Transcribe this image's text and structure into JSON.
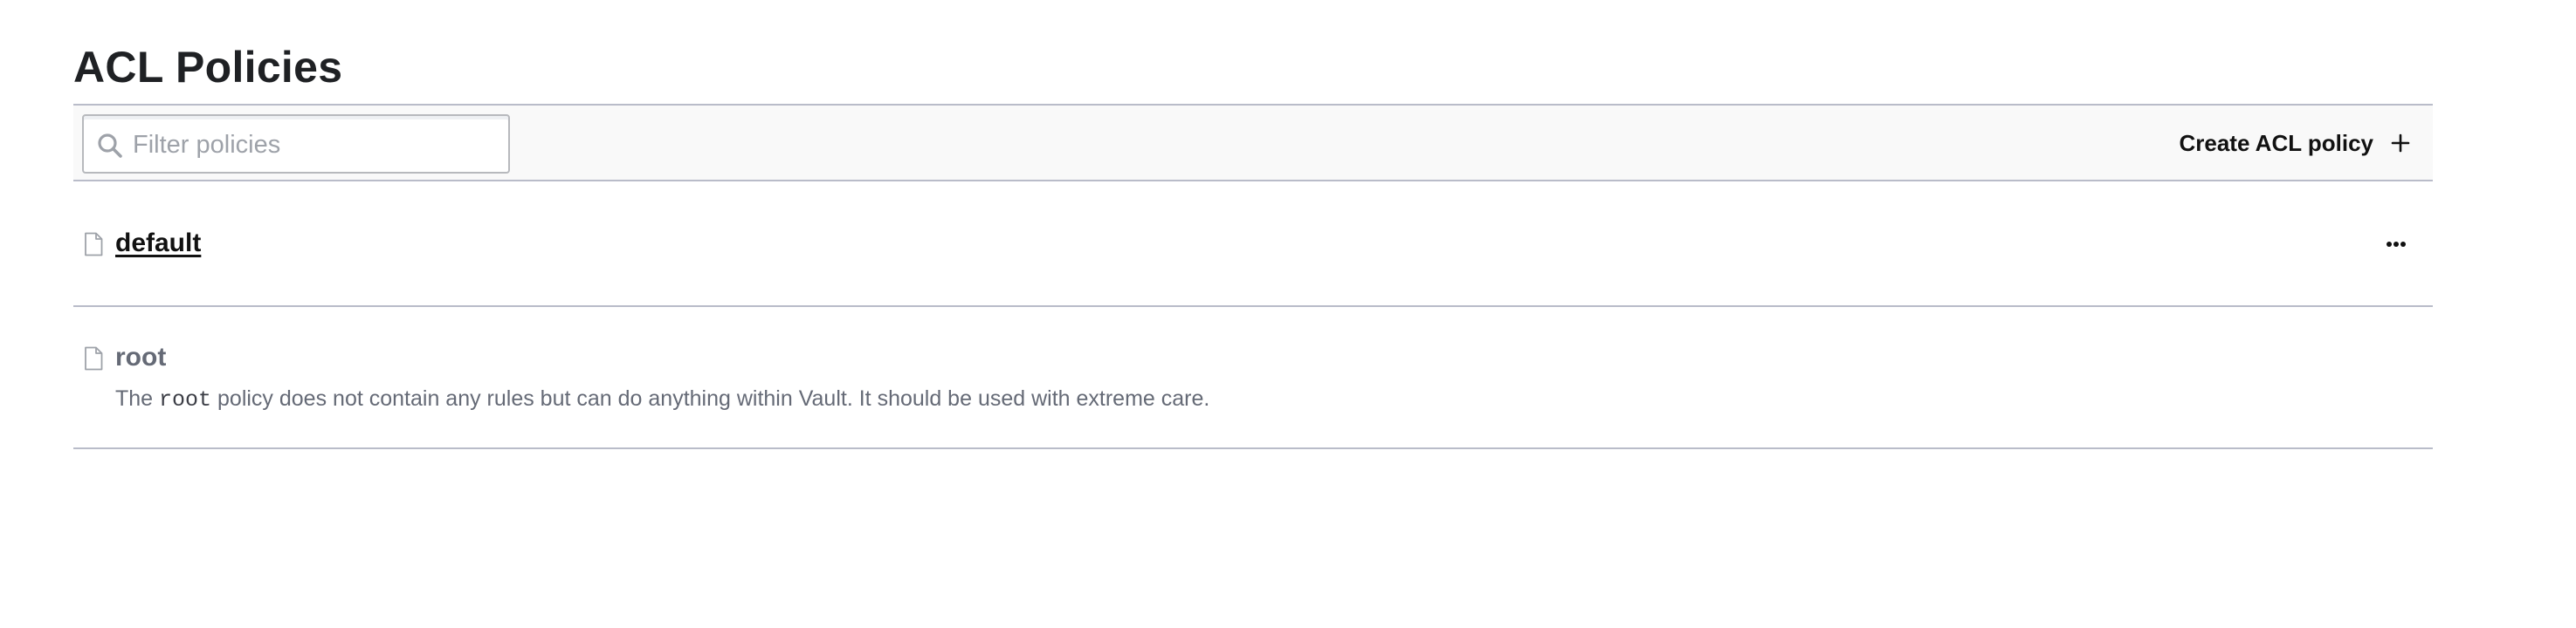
{
  "page": {
    "title": "ACL Policies"
  },
  "toolbar": {
    "search": {
      "placeholder": "Filter policies",
      "value": "",
      "icon": "search-icon"
    },
    "create_button": {
      "label": "Create ACL policy",
      "icon": "plus-icon"
    }
  },
  "policies": [
    {
      "name": "default",
      "icon": "file-icon",
      "is_link": true,
      "menu_icon": "more-horizontal-icon"
    },
    {
      "name": "root",
      "icon": "file-icon",
      "is_link": false,
      "description_prefix": "The",
      "description_code": "root",
      "description_suffix": "policy does not contain any rules but can do anything within Vault. It should be used with extreme care."
    }
  ],
  "colors": {
    "text_primary": "#1f2124",
    "text_muted": "#656a76",
    "border": "#b9bcc9",
    "toolbar_bg": "#f9f9f9",
    "placeholder": "#9ea2a9"
  }
}
